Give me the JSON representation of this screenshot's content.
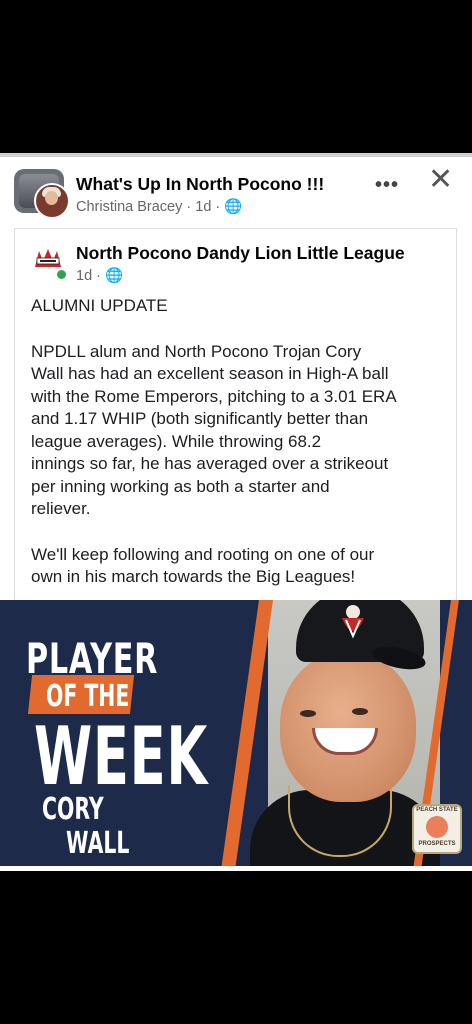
{
  "post": {
    "group_name": "What's Up In North Pocono !!!",
    "author_meta": "Christina Bracey · 1d · 🌐",
    "more_label": "•••",
    "close_label": "✕"
  },
  "shared": {
    "page_name": "North Pocono Dandy Lion Little League",
    "page_meta": "1d · 🌐",
    "paragraphs": [
      "ALUMNI UPDATE",
      "NPDLL alum and North Pocono Trojan Cory\nWall has had an excellent season in High-A ball\nwith the Rome Emperors, pitching to a 3.01 ERA\nand 1.17 WHIP (both significantly better than\nleague averages).    While throwing 68.2\ninnings so far, he has averaged over a strikeout\nper inning working as both a starter and\nreliever.",
      "We'll keep following and rooting on one of our\nown in his march towards the Big Leagues!"
    ]
  },
  "graphic": {
    "line1": "PLAYER",
    "line2": "OF THE",
    "line3": "WEEK",
    "first_name": "CORY",
    "last_name": "WALL",
    "badge_top": "PEACH STATE",
    "badge_bottom": "PROSPECTS",
    "colors": {
      "navy": "#1d2a4a",
      "orange": "#e36a2e"
    }
  },
  "icons": [
    "group-avatar-icon",
    "globe-icon",
    "more-icon",
    "close-icon",
    "online-status-icon"
  ]
}
